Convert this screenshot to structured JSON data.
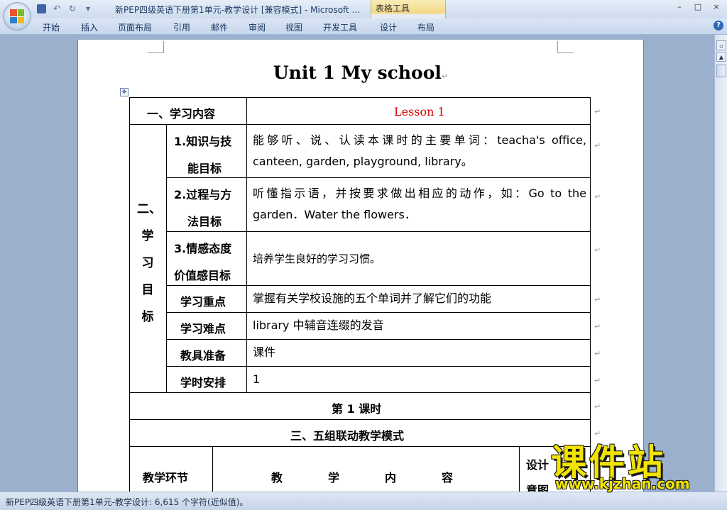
{
  "window": {
    "title": "新PEP四级英语下册第1单元-教学设计 [兼容模式] - Microsoft ...",
    "context_tab_group": "表格工具",
    "controls": [
      "–",
      "□",
      "×"
    ]
  },
  "ribbon": {
    "tabs": [
      "开始",
      "插入",
      "页面布局",
      "引用",
      "邮件",
      "审阅",
      "视图",
      "开发工具"
    ],
    "context_tabs": [
      "设计",
      "布局"
    ],
    "help": "?"
  },
  "document": {
    "heading": "Unit 1 My school",
    "paragraph_mark": "↵",
    "table": {
      "content_label": "一、学习内容",
      "lesson": "Lesson 1",
      "lesson_color": "#d40000",
      "objectives_label": [
        "二、",
        "学",
        "习",
        "目",
        "标"
      ],
      "rows": [
        {
          "label": [
            "1.知识与技",
            "能目标"
          ],
          "content": [
            "能够听、说、认读本课时的主要单词：teacha's office,",
            "canteen, garden, playground, library。"
          ]
        },
        {
          "label": [
            "2.过程与方",
            "法目标"
          ],
          "content": [
            "听懂指示语，并按要求做出相应的动作，如：Go to the",
            "garden．Water the flowers．"
          ]
        },
        {
          "label": [
            "3.情感态度",
            "价值感目标"
          ],
          "content": [
            "培养学生良好的学习习惯。"
          ]
        },
        {
          "label": [
            "学习重点"
          ],
          "content": [
            "掌握有关学校设施的五个单词并了解它们的功能"
          ]
        },
        {
          "label": [
            "学习难点"
          ],
          "content": [
            "library 中辅音连缀的发音"
          ]
        },
        {
          "label": [
            "教具准备"
          ],
          "content": [
            "课件"
          ]
        },
        {
          "label": [
            "学时安排"
          ],
          "content": [
            "1"
          ]
        }
      ],
      "lesson_period": "第 1 课时",
      "mode_title": "三、五组联动教学模式",
      "col_stage": "教学环节",
      "col_content": [
        "教",
        "学",
        "内",
        "容"
      ],
      "col_design": [
        "设计",
        "意图"
      ]
    }
  },
  "statusbar": {
    "text": "新PEP四级英语下册第1单元-教学设计: 6,615 个字符(近似值)。"
  },
  "watermark": {
    "logo": "课件站",
    "url": "www.kjzhan.com"
  }
}
